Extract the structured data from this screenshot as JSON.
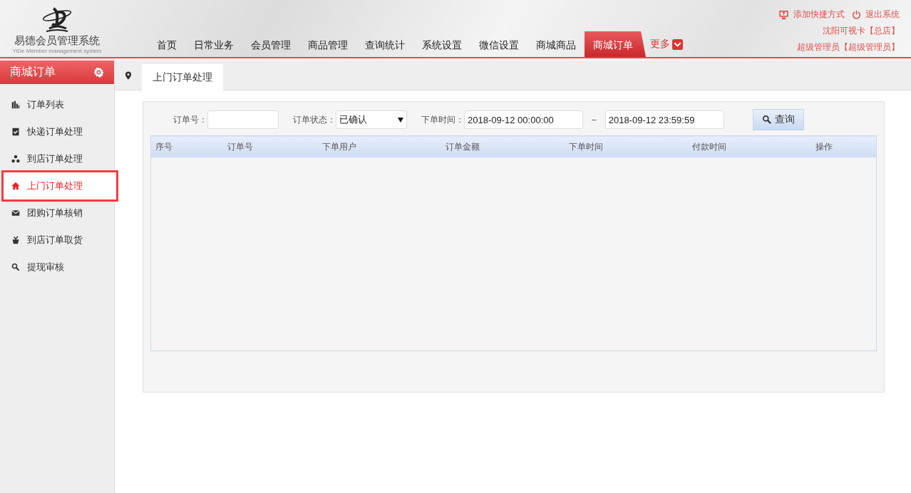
{
  "logo": {
    "title": "易德会员管理系统",
    "subtitle": "YiDe Member management system"
  },
  "nav": [
    {
      "label": "首页",
      "selected": false
    },
    {
      "label": "日常业务",
      "selected": false
    },
    {
      "label": "会员管理",
      "selected": false
    },
    {
      "label": "商品管理",
      "selected": false
    },
    {
      "label": "查询统计",
      "selected": false
    },
    {
      "label": "系统设置",
      "selected": false
    },
    {
      "label": "微信设置",
      "selected": false
    },
    {
      "label": "商城商品",
      "selected": false
    },
    {
      "label": "商城订单",
      "selected": true
    }
  ],
  "more": "更多",
  "top_links": [
    {
      "kind": "shortcut",
      "label": "添加快捷方式"
    },
    {
      "kind": "logout",
      "label": "退出系统"
    }
  ],
  "store": "沈阳可视卡【总店】",
  "user": "超级管理员【超级管理员】",
  "sidebar": {
    "title": "商城订单",
    "items": [
      {
        "label": "订单列表",
        "kind": "chart",
        "selected": false
      },
      {
        "label": "快递订单处理",
        "kind": "check",
        "selected": false
      },
      {
        "label": "到店订单处理",
        "kind": "cluster",
        "selected": false
      },
      {
        "label": "上门订单处理",
        "kind": "home",
        "selected": true
      },
      {
        "label": "团购订单核销",
        "kind": "mail",
        "selected": false
      },
      {
        "label": "到店订单取货",
        "kind": "basket",
        "selected": false
      },
      {
        "label": "提现审核",
        "kind": "search",
        "selected": false
      }
    ]
  },
  "page_tabs": [
    {
      "label": "上门订单处理",
      "selected": true
    }
  ],
  "filters": {
    "order_no": {
      "label": "订单号："
    },
    "status": {
      "label": "订单状态：",
      "value": "已确认"
    },
    "time": {
      "label": "下单时间：",
      "from": "2018-09-12 00:00:00",
      "separator": "–",
      "to": "2018-09-12 23:59:59"
    },
    "search_button": "查询"
  },
  "table": {
    "columns": [
      "序号",
      "订单号",
      "下单用户",
      "订单金额",
      "下单时间",
      "付款时间",
      "操作"
    ]
  }
}
